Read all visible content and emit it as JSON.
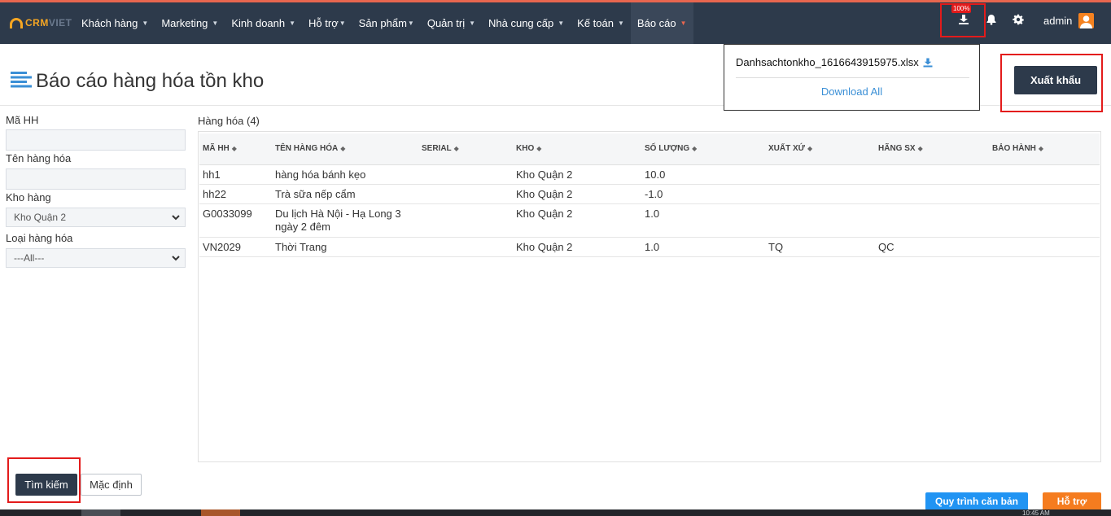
{
  "brand": {
    "name_part1": "CRM",
    "name_part2": "VIET"
  },
  "nav": {
    "items": [
      {
        "label": "Khách hàng"
      },
      {
        "label": "Marketing"
      },
      {
        "label": "Kinh doanh"
      },
      {
        "label": "Hỗ trợ"
      },
      {
        "label": "Sản phẩm"
      },
      {
        "label": "Quản trị"
      },
      {
        "label": "Nhà cung cấp"
      },
      {
        "label": "Kế toán"
      },
      {
        "label": "Báo cáo"
      }
    ],
    "active": "Báo cáo",
    "download_progress": "100%",
    "user": "admin",
    "icons": [
      "download-icon",
      "bell-icon",
      "gear-icon",
      "avatar"
    ]
  },
  "download_popup": {
    "filename": "Danhsachtonkho_1616643915975.xlsx",
    "download_all": "Download All"
  },
  "page": {
    "title": "Báo cáo hàng hóa tồn kho",
    "export_label": "Xuất khẩu"
  },
  "filters": {
    "code_label": "Mã HH",
    "code_value": "",
    "name_label": "Tên hàng hóa",
    "name_value": "",
    "warehouse_label": "Kho hàng",
    "warehouse_value": "Kho Quận 2",
    "type_label": "Loại hàng hóa",
    "type_value": "---All---",
    "search_label": "Tìm kiếm",
    "reset_label": "Mặc định"
  },
  "table": {
    "section_label": "Hàng hóa (4)",
    "columns": [
      "MÃ HH",
      "TÊN HÀNG HÓA",
      "SERIAL",
      "KHO",
      "SỐ LƯỢNG",
      "XUẤT XỨ",
      "HÃNG SX",
      "BẢO HÀNH"
    ],
    "rows": [
      [
        "hh1",
        "hàng hóa bánh kẹo",
        "",
        "Kho Quận 2",
        "10.0",
        "",
        "",
        ""
      ],
      [
        "hh22",
        "Trà sữa nếp cẩm",
        "",
        "Kho Quận 2",
        "-1.0",
        "",
        "",
        ""
      ],
      [
        "G0033099",
        "Du lịch Hà Nội - Hạ Long 3 ngày 2 đêm",
        "",
        "Kho Quận 2",
        "1.0",
        "",
        "",
        ""
      ],
      [
        "VN2029",
        "Thời Trang",
        "",
        "Kho Quận 2",
        "1.0",
        "TQ",
        "QC",
        ""
      ]
    ]
  },
  "footer": {
    "process_label": "Quy trình căn bản",
    "help_label": "Hỗ trợ",
    "clock": "10:45 AM"
  },
  "colors": {
    "navbar": "#2d3a4b",
    "accent_orange": "#f57c1f",
    "accent_blue": "#2194f3",
    "highlight_red": "#e31b1b",
    "top_line": "#e8664f"
  }
}
